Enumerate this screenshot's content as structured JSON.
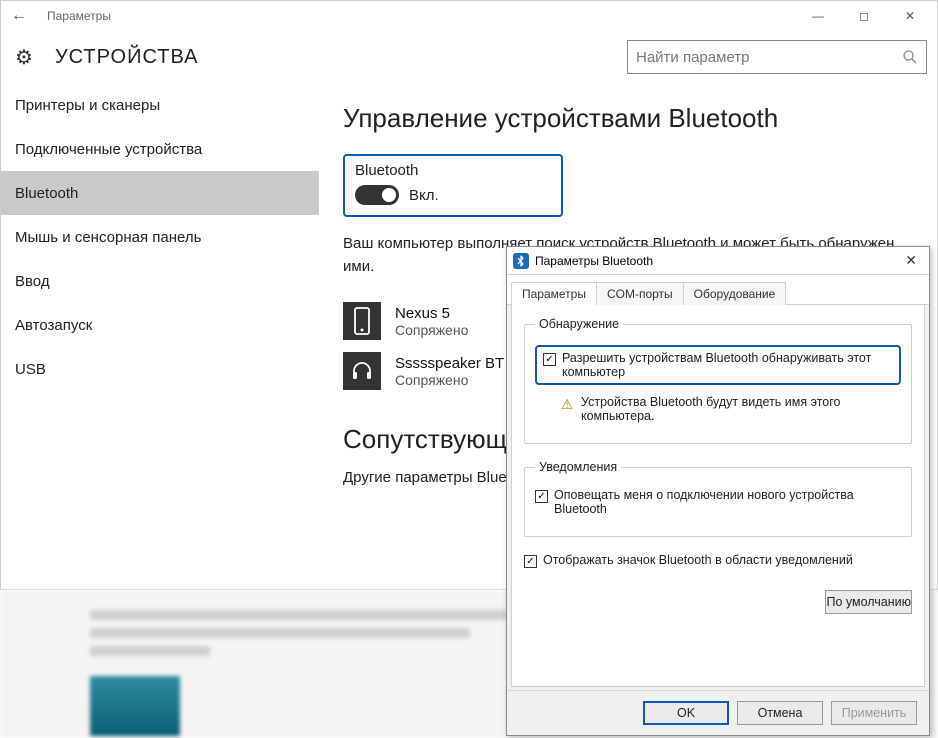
{
  "window": {
    "title": "Параметры",
    "page_title": "УСТРОЙСТВА",
    "search_placeholder": "Найти параметр"
  },
  "sidebar": {
    "items": [
      {
        "label": "Принтеры и сканеры"
      },
      {
        "label": "Подключенные устройства"
      },
      {
        "label": "Bluetooth"
      },
      {
        "label": "Мышь и сенсорная панель"
      },
      {
        "label": "Ввод"
      },
      {
        "label": "Автозапуск"
      },
      {
        "label": "USB"
      }
    ],
    "selected_index": 2
  },
  "main": {
    "heading": "Управление устройствами Bluetooth",
    "toggle": {
      "label": "Bluetooth",
      "state_label": "Вкл.",
      "on": true
    },
    "description": "Ваш компьютер выполняет поиск устройств Bluetooth и может быть обнаружен ими.",
    "devices": [
      {
        "name": "Nexus 5",
        "status": "Сопряжено",
        "icon": "phone"
      },
      {
        "name": "Ssssspeaker BT",
        "status": "Сопряжено",
        "icon": "headset"
      }
    ],
    "related_heading": "Сопутствующи",
    "related_sub": "Другие параметры Blue"
  },
  "dialog": {
    "title": "Параметры Bluetooth",
    "tabs": [
      "Параметры",
      "COM-порты",
      "Оборудование"
    ],
    "active_tab": 0,
    "discovery": {
      "legend": "Обнаружение",
      "allow_label": "Разрешить устройствам Bluetooth обнаруживать этот компьютер",
      "allow_checked": true,
      "warn_text": "Устройства Bluetooth будут видеть имя этого компьютера."
    },
    "notifications": {
      "legend": "Уведомления",
      "notify_label": "Оповещать меня о подключении нового устройства Bluetooth",
      "notify_checked": true
    },
    "tray": {
      "label": "Отображать значок Bluetooth в области уведомлений",
      "checked": true
    },
    "buttons": {
      "defaults": "По умолчанию",
      "ok": "OK",
      "cancel": "Отмена",
      "apply": "Применить"
    }
  }
}
